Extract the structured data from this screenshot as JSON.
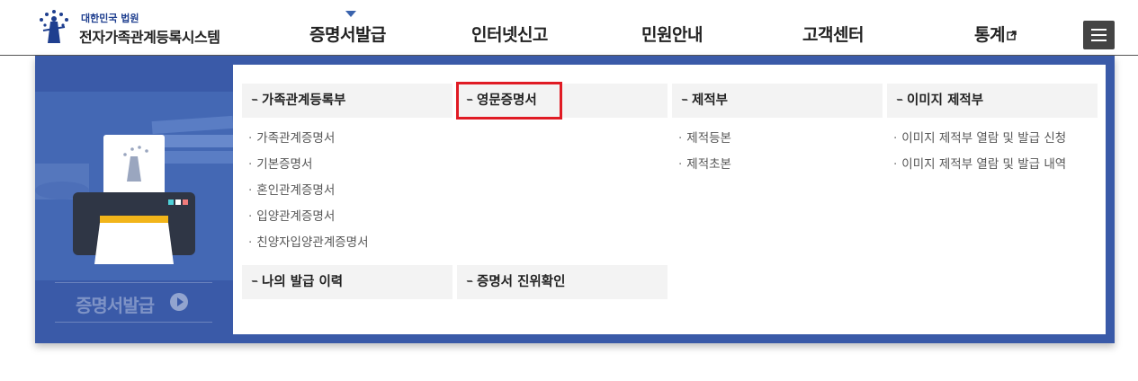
{
  "header": {
    "logo_small": "대한민국 법원",
    "logo_big": "전자가족관계등록시스템",
    "nav": [
      "증명서발급",
      "인터넷신고",
      "민원안내",
      "고객센터",
      "통계"
    ],
    "menu_icon": "hamburger-icon",
    "external_icon": "external-link-icon"
  },
  "illustration": {
    "label": "증명서발급",
    "icon": "printer-illustration"
  },
  "categories": {
    "family": {
      "title": "가족관계등록부",
      "items": [
        "가족관계증명서",
        "기본증명서",
        "혼인관계증명서",
        "입양관계증명서",
        "친양자입양관계증명서"
      ]
    },
    "english": {
      "title": "영문증명서",
      "items": []
    },
    "jejeok": {
      "title": "제적부",
      "items": [
        "제적등본",
        "제적초본"
      ]
    },
    "image": {
      "title": "이미지 제적부",
      "items": [
        "이미지 제적부 열람 및 발급 신청",
        "이미지 제적부 열람 및 발급 내역"
      ]
    },
    "history": {
      "title": "나의 발급 이력"
    },
    "verify": {
      "title": "증명서 진위확인"
    }
  },
  "colors": {
    "panel": "#3a5aa8",
    "highlight": "#e01b24",
    "brand": "#1f3f8f"
  }
}
